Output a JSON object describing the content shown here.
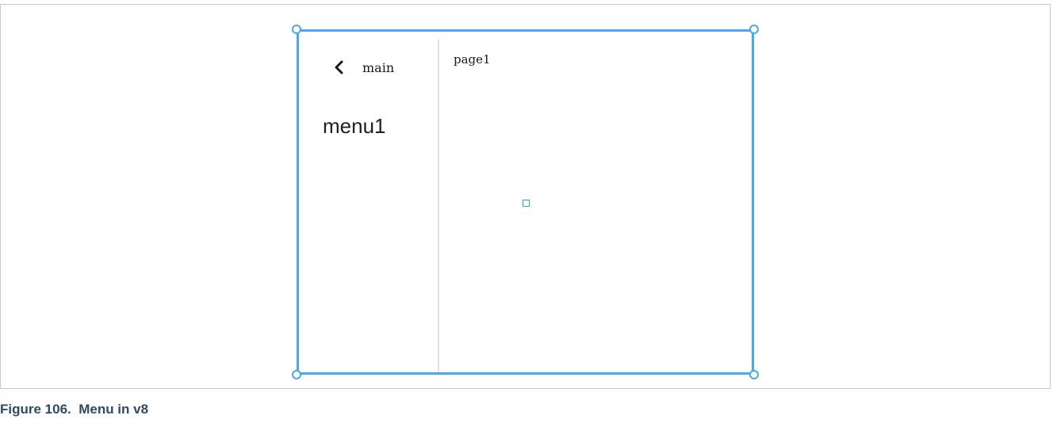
{
  "menu_widget": {
    "back_label": "main",
    "menu_item_label": "menu1",
    "page_title": "page1"
  },
  "caption": {
    "text": "Figure 106.  Menu in v8"
  },
  "colors": {
    "selection_border": "#4aa8ee",
    "divider": "#e2e2e2",
    "anchor_marker": "#27a9cf",
    "caption_text": "#2e4a6b"
  },
  "icons": {
    "back": "chevron-left-icon"
  }
}
